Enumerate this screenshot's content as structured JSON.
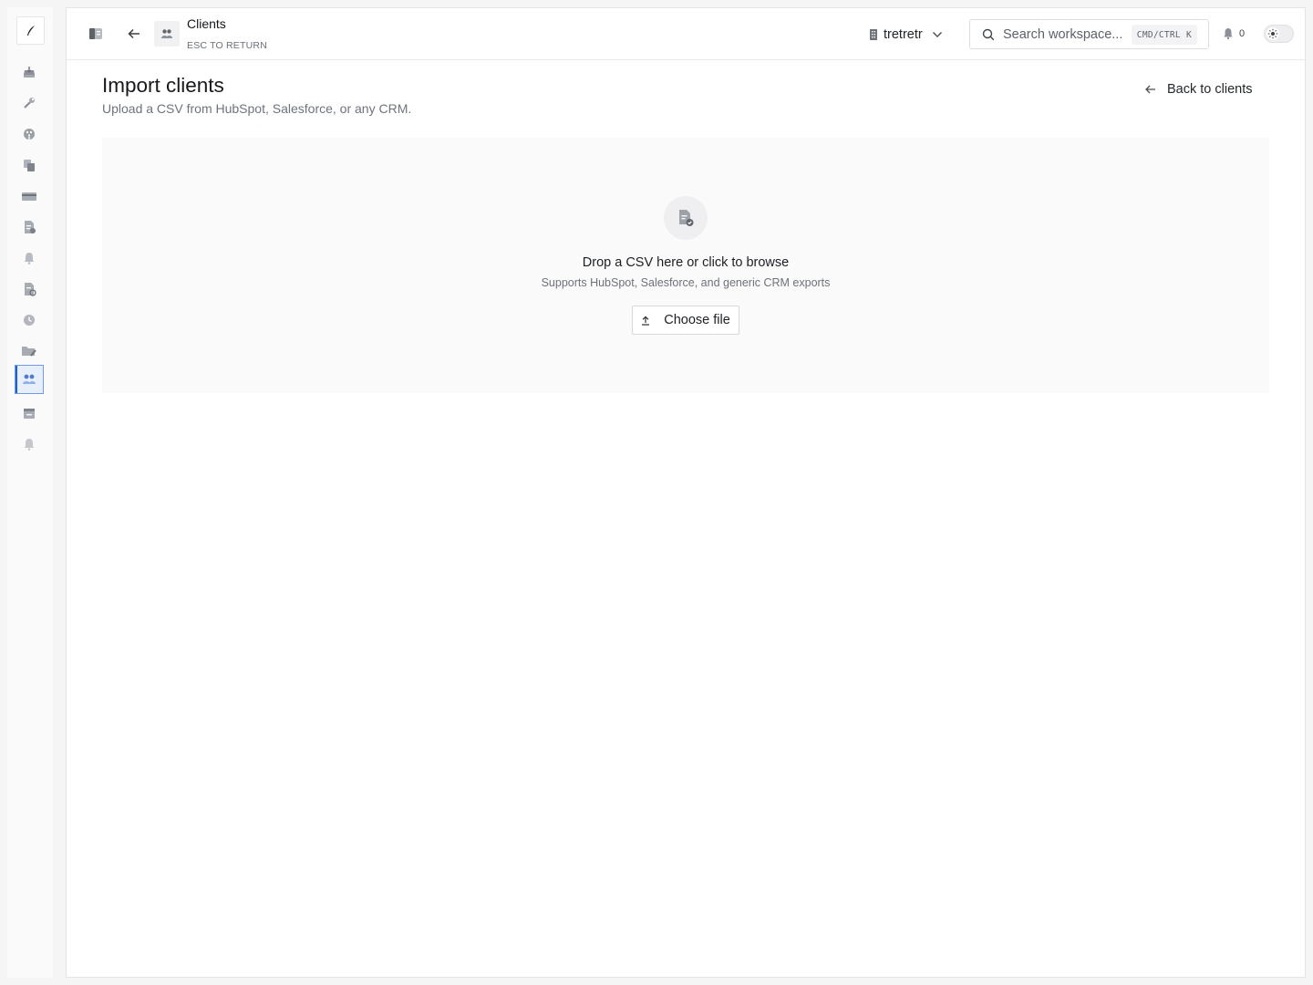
{
  "rail": {
    "logo_icon": "quill-icon",
    "items": [
      {
        "icon": "inbox-tray-icon",
        "active": false
      },
      {
        "icon": "wrench-icon",
        "active": false
      },
      {
        "icon": "palette-icon",
        "active": false
      },
      {
        "icon": "copy-icon",
        "active": false
      },
      {
        "icon": "credit-card-icon",
        "active": false
      },
      {
        "icon": "document-check-icon",
        "active": false
      },
      {
        "icon": "bell-icon",
        "active": false
      },
      {
        "icon": "document-refresh-icon",
        "active": false
      },
      {
        "icon": "clock-icon",
        "active": false
      },
      {
        "icon": "folder-edit-icon",
        "active": false
      },
      {
        "icon": "clients-icon",
        "active": true
      },
      {
        "icon": "calendar-icon",
        "active": false
      },
      {
        "icon": "bell-icon",
        "active": false
      }
    ]
  },
  "header": {
    "title": "Clients",
    "subtitle": "ESC TO RETURN",
    "workspace": "tretretr",
    "search_placeholder": "Search workspace...",
    "search_shortcut": "CMD/CTRL K",
    "notification_count": "0"
  },
  "page": {
    "title": "Import clients",
    "subtitle": "Upload a CSV from HubSpot, Salesforce, or any CRM.",
    "back_label": "Back to clients"
  },
  "dropzone": {
    "title": "Drop a CSV here or click to browse",
    "subtitle": "Supports HubSpot, Salesforce, and generic CRM exports",
    "button_label": "Choose file"
  },
  "colors": {
    "accent": "#1f5fd6",
    "active_bg": "#e7effc"
  }
}
